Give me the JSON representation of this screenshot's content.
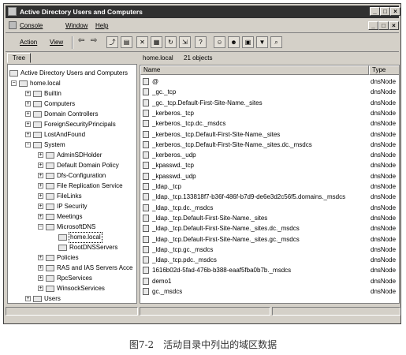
{
  "window": {
    "title": "Active Directory Users and Computers"
  },
  "menu1": {
    "console": "Console",
    "window": "Window",
    "help": "Help"
  },
  "menu2": {
    "action": "Action",
    "view": "View"
  },
  "tree": {
    "tab": "Tree",
    "items": [
      {
        "label": "Active Directory Users and Computers"
      },
      {
        "label": "home.local"
      },
      {
        "label": "Builtin"
      },
      {
        "label": "Computers"
      },
      {
        "label": "Domain Controllers"
      },
      {
        "label": "ForeignSecurityPrincipals"
      },
      {
        "label": "LostAndFound"
      },
      {
        "label": "System"
      },
      {
        "label": "AdminSDHolder"
      },
      {
        "label": "Default Domain Policy"
      },
      {
        "label": "Dfs-Configuration"
      },
      {
        "label": "File Replication Service"
      },
      {
        "label": "FileLinks"
      },
      {
        "label": "IP Security"
      },
      {
        "label": "Meetings"
      },
      {
        "label": "MicrosoftDNS"
      },
      {
        "label": "home.local"
      },
      {
        "label": "RootDNSServers"
      },
      {
        "label": "Policies"
      },
      {
        "label": "RAS and IAS Servers Acce"
      },
      {
        "label": "RpcServices"
      },
      {
        "label": "WinsockServices"
      },
      {
        "label": "Users"
      }
    ]
  },
  "right": {
    "path": "home.local",
    "count": "21 objects"
  },
  "list": {
    "col_name": "Name",
    "col_type": "Type",
    "rows": [
      {
        "name": "@",
        "type": "dnsNode"
      },
      {
        "name": "_gc._tcp",
        "type": "dnsNode"
      },
      {
        "name": "_gc._tcp.Default-First-Site-Name._sites",
        "type": "dnsNode"
      },
      {
        "name": "_kerberos._tcp",
        "type": "dnsNode"
      },
      {
        "name": "_kerberos._tcp.dc._msdcs",
        "type": "dnsNode"
      },
      {
        "name": "_kerberos._tcp.Default-First-Site-Name._sites",
        "type": "dnsNode"
      },
      {
        "name": "_kerberos._tcp.Default-First-Site-Name._sites.dc._msdcs",
        "type": "dnsNode"
      },
      {
        "name": "_kerberos._udp",
        "type": "dnsNode"
      },
      {
        "name": "_kpasswd._tcp",
        "type": "dnsNode"
      },
      {
        "name": "_kpasswd._udp",
        "type": "dnsNode"
      },
      {
        "name": "_ldap._tcp",
        "type": "dnsNode"
      },
      {
        "name": "_ldap._tcp.133818f7-b36f-486f-b7d9-de6e3d2c56f5.domains._msdcs",
        "type": "dnsNode"
      },
      {
        "name": "_ldap._tcp.dc._msdcs",
        "type": "dnsNode"
      },
      {
        "name": "_ldap._tcp.Default-First-Site-Name._sites",
        "type": "dnsNode"
      },
      {
        "name": "_ldap._tcp.Default-First-Site-Name._sites.dc._msdcs",
        "type": "dnsNode"
      },
      {
        "name": "_ldap._tcp.Default-First-Site-Name._sites.gc._msdcs",
        "type": "dnsNode"
      },
      {
        "name": "_ldap._tcp.gc._msdcs",
        "type": "dnsNode"
      },
      {
        "name": "_ldap._tcp.pdc._msdcs",
        "type": "dnsNode"
      },
      {
        "name": "1616b02d-5fad-476b-b388-eaaf5fba0b7b._msdcs",
        "type": "dnsNode"
      },
      {
        "name": "demo1",
        "type": "dnsNode"
      },
      {
        "name": "gc._msdcs",
        "type": "dnsNode"
      }
    ]
  },
  "caption": "图7-2　活动目录中列出的域区数据"
}
